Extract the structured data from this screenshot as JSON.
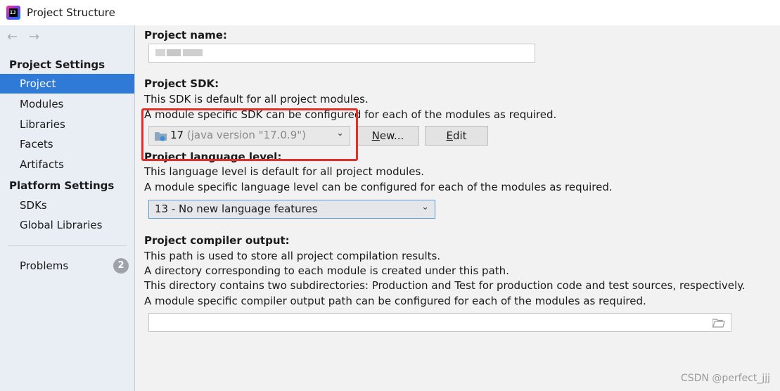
{
  "window": {
    "title": "Project Structure",
    "app_icon_letters": "IJ"
  },
  "navigation": {
    "back_icon": "arrow-left-icon",
    "forward_icon": "arrow-right-icon"
  },
  "sidebar": {
    "project_settings_header": "Project Settings",
    "project_settings_items": [
      {
        "label": "Project",
        "selected": true
      },
      {
        "label": "Modules"
      },
      {
        "label": "Libraries"
      },
      {
        "label": "Facets"
      },
      {
        "label": "Artifacts"
      }
    ],
    "platform_settings_header": "Platform Settings",
    "platform_settings_items": [
      {
        "label": "SDKs"
      },
      {
        "label": "Global Libraries"
      }
    ],
    "problems": {
      "label": "Problems",
      "count": "2"
    }
  },
  "main": {
    "project_name": {
      "label": "Project name:",
      "value": ""
    },
    "project_sdk": {
      "label": "Project SDK:",
      "desc1": "This SDK is default for all project modules.",
      "desc2": "A module specific SDK can be configured for each of the modules as required.",
      "selected_sdk": "17",
      "selected_sdk_version": "(java version \"17.0.9\")",
      "new_button": {
        "prefix": "",
        "mnemonic": "N",
        "suffix": "ew..."
      },
      "edit_button": {
        "prefix": "",
        "mnemonic": "E",
        "suffix": "dit"
      }
    },
    "project_language_level": {
      "label": "Project language level:",
      "desc1": "This language level is default for all project modules.",
      "desc2": "A module specific language level can be configured for each of the modules as required.",
      "selected": "13 - No new language features"
    },
    "project_compiler_output": {
      "label": "Project compiler output:",
      "desc1": "This path is used to store all project compilation results.",
      "desc2": "A directory corresponding to each module is created under this path.",
      "desc3": "This directory contains two subdirectories: Production and Test for production code and test sources, respectively.",
      "desc4": "A module specific compiler output path can be configured for each of the modules as required.",
      "value": ""
    }
  },
  "annotation": {
    "highlight_color": "#e0302a"
  },
  "watermark": "CSDN @perfect_jjj",
  "colors": {
    "selection": "#2f7ad6",
    "sidebar_bg": "#e9eef5",
    "main_bg": "#f2f2f2"
  }
}
